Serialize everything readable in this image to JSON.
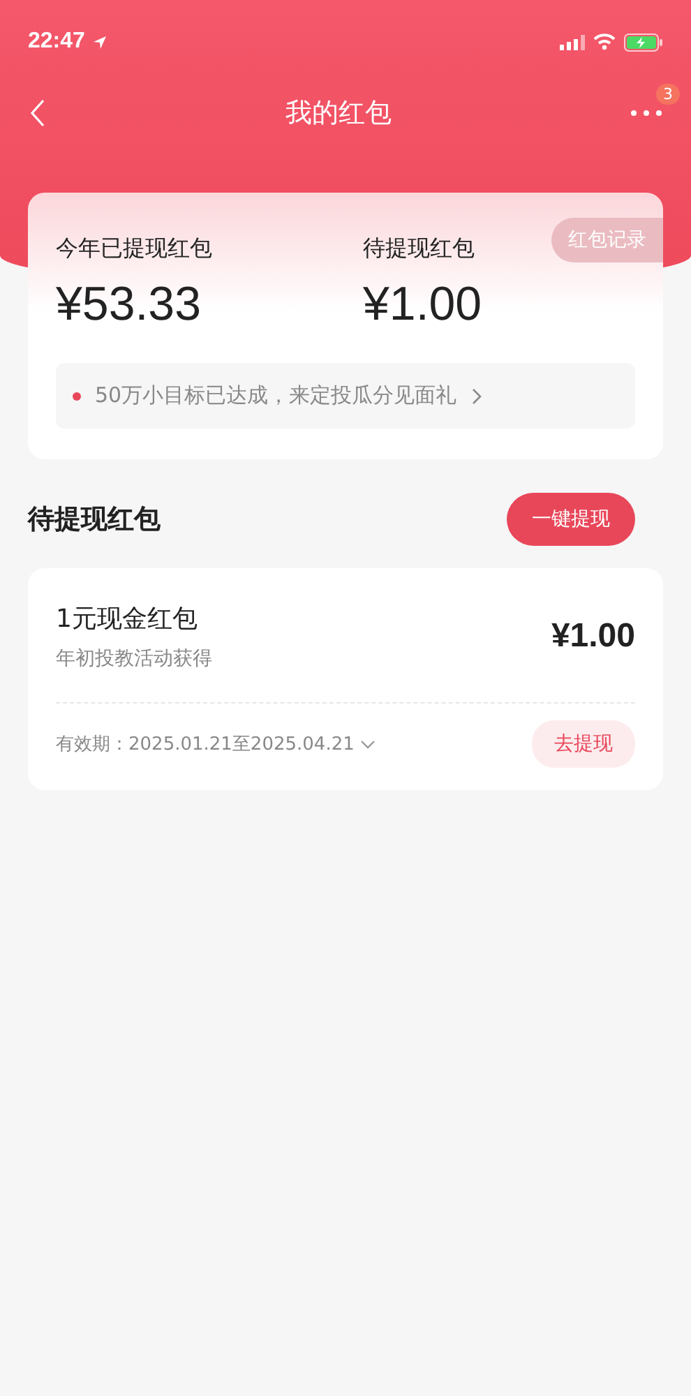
{
  "status_bar": {
    "time": "22:47"
  },
  "nav": {
    "title": "我的红包",
    "badge": "3"
  },
  "summary": {
    "record_button": "红包记录",
    "stats": [
      {
        "label": "今年已提现红包",
        "value": "¥53.33"
      },
      {
        "label": "待提现红包",
        "value": "¥1.00"
      }
    ],
    "notice": "50万小目标已达成，来定投瓜分见面礼"
  },
  "section": {
    "title": "待提现红包",
    "action": "一键提现"
  },
  "packets": [
    {
      "name": "1元现金红包",
      "source": "年初投教活动获得",
      "amount": "¥1.00",
      "validity": "有效期：2025.01.21至2025.04.21",
      "action": "去提现"
    }
  ]
}
